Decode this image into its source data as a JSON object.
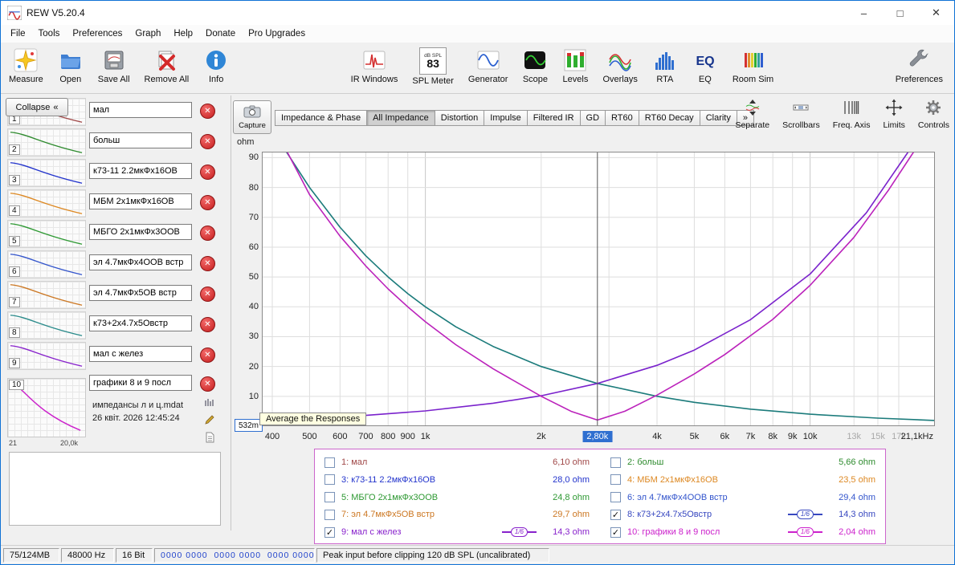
{
  "window": {
    "title": "REW V5.20.4",
    "minimize": "–",
    "maximize": "□",
    "close": "✕"
  },
  "menu": {
    "items": [
      "File",
      "Tools",
      "Preferences",
      "Graph",
      "Help",
      "Donate",
      "Pro Upgrades"
    ]
  },
  "toolbar": {
    "left": [
      {
        "label": "Measure",
        "icon": "measure-icon"
      },
      {
        "label": "Open",
        "icon": "open-icon"
      },
      {
        "label": "Save All",
        "icon": "save-all-icon"
      },
      {
        "label": "Remove All",
        "icon": "remove-all-icon"
      },
      {
        "label": "Info",
        "icon": "info-icon"
      }
    ],
    "center": [
      {
        "label": "IR Windows",
        "icon": "ir-windows-icon"
      },
      {
        "label": "SPL Meter",
        "icon": "spl-meter-icon"
      },
      {
        "label": "Generator",
        "icon": "generator-icon"
      },
      {
        "label": "Scope",
        "icon": "scope-icon"
      },
      {
        "label": "Levels",
        "icon": "levels-icon"
      },
      {
        "label": "Overlays",
        "icon": "overlays-icon"
      },
      {
        "label": "RTA",
        "icon": "rta-icon"
      },
      {
        "label": "EQ",
        "icon": "eq-icon"
      },
      {
        "label": "Room Sim",
        "icon": "room-sim-icon"
      }
    ],
    "right": [
      {
        "label": "Preferences",
        "icon": "wrench-icon"
      }
    ],
    "spl": {
      "unit": "dB SPL",
      "value": "83"
    }
  },
  "sidebar": {
    "collapse_label": "Collapse",
    "collapse_chevron": "«",
    "measurements": [
      {
        "num": "1",
        "name": "мал",
        "color": "#a04848"
      },
      {
        "num": "2",
        "name": "больш",
        "color": "#2e8b2e"
      },
      {
        "num": "3",
        "name": "к73-11 2.2мкФх16ОВ",
        "color": "#2233cc"
      },
      {
        "num": "4",
        "name": "МБМ 2х1мкФх16ОВ",
        "color": "#dd8822"
      },
      {
        "num": "5",
        "name": "МБГО 2х1мкФх3ООВ",
        "color": "#2e9933"
      },
      {
        "num": "6",
        "name": "эл 4.7мкФх4ООВ встр",
        "color": "#3355cc"
      },
      {
        "num": "7",
        "name": "эл 4.7мкФх5ОВ встр",
        "color": "#cc7722"
      },
      {
        "num": "8",
        "name": "к73+2х4.7х5Овстр",
        "color": "#2a8b8b"
      },
      {
        "num": "9",
        "name": "мал с желез",
        "color": "#8822cc"
      },
      {
        "num": "10",
        "name": "графики 8 и 9 посл",
        "color": "#cc22cc"
      }
    ],
    "selected": {
      "num": "10",
      "file": "импедансы л и ц.mdat",
      "date": "26 квіт. 2026 12:45:24",
      "axis_left": "21",
      "axis_right": "20,0k"
    }
  },
  "graphbar": {
    "capture_label": "Capture",
    "tabs": [
      {
        "label": "Impedance & Phase",
        "active": false
      },
      {
        "label": "All Impedance",
        "active": true
      },
      {
        "label": "Distortion",
        "active": false
      },
      {
        "label": "Impulse",
        "active": false
      },
      {
        "label": "Filtered IR",
        "active": false
      },
      {
        "label": "GD",
        "active": false
      },
      {
        "label": "RT60",
        "active": false
      },
      {
        "label": "RT60 Decay",
        "active": false
      },
      {
        "label": "Clarity",
        "active": false
      },
      {
        "label": "»",
        "active": false
      }
    ],
    "tools": [
      {
        "label": "Separate",
        "icon": "separate-icon"
      },
      {
        "label": "Scrollbars",
        "icon": "scrollbars-icon"
      },
      {
        "label": "Freq. Axis",
        "icon": "freq-axis-icon"
      },
      {
        "label": "Limits",
        "icon": "limits-icon"
      },
      {
        "label": "Controls",
        "icon": "controls-icon"
      }
    ]
  },
  "graph": {
    "ylabel": "ohm",
    "yticks": [
      90,
      80,
      70,
      60,
      50,
      40,
      30,
      20,
      10
    ],
    "xticks": [
      {
        "f": 400,
        "label": "400"
      },
      {
        "f": 500,
        "label": "500"
      },
      {
        "f": 600,
        "label": "600"
      },
      {
        "f": 700,
        "label": "700"
      },
      {
        "f": 800,
        "label": "800"
      },
      {
        "f": 900,
        "label": "900"
      },
      {
        "f": 1000,
        "label": "1k"
      },
      {
        "f": 2000,
        "label": "2k"
      },
      {
        "f": 4000,
        "label": "4k"
      },
      {
        "f": 5000,
        "label": "5k"
      },
      {
        "f": 6000,
        "label": "6k"
      },
      {
        "f": 7000,
        "label": "7k"
      },
      {
        "f": 8000,
        "label": "8k"
      },
      {
        "f": 9000,
        "label": "9k"
      },
      {
        "f": 10000,
        "label": "10k"
      },
      {
        "f": 13000,
        "label": "13k",
        "muted": true
      },
      {
        "f": 15000,
        "label": "15k",
        "muted": true
      },
      {
        "f": 17000,
        "label": "17k",
        "muted": true
      },
      {
        "f": 21100,
        "label": "21,1kHz"
      }
    ],
    "gridfreqs": [
      400,
      500,
      600,
      700,
      800,
      900,
      1000,
      2000,
      3000,
      4000,
      5000,
      6000,
      7000,
      8000,
      9000,
      10000,
      13000,
      15000,
      17000,
      21100
    ],
    "corner_value": "532m",
    "cursor_label": "2,80k",
    "cursor_freq": 2800,
    "tooltip": "Average the Responses"
  },
  "chart_data": {
    "type": "line",
    "x_scale": "log",
    "x_units": "Hz",
    "ylabel": "ohm",
    "xlim": [
      400,
      22500
    ],
    "ylim": [
      0.532,
      92
    ],
    "cursor": {
      "x": 2800,
      "label": "2,80k"
    },
    "series": [
      {
        "name": "8: к73+2х4.7х5Овстр",
        "color": "#1b7b7b",
        "cursor_value_ohm": 14.3,
        "points": [
          [
            430,
            93
          ],
          [
            500,
            80
          ],
          [
            600,
            66.7
          ],
          [
            700,
            57.1
          ],
          [
            800,
            50
          ],
          [
            900,
            44.4
          ],
          [
            1000,
            40
          ],
          [
            1200,
            33.3
          ],
          [
            1500,
            26.7
          ],
          [
            2000,
            20
          ],
          [
            2800,
            14.3
          ],
          [
            4000,
            10
          ],
          [
            5000,
            8
          ],
          [
            7000,
            5.7
          ],
          [
            10000,
            4
          ],
          [
            15000,
            2.7
          ],
          [
            21100,
            1.9
          ],
          [
            22500,
            1.8
          ]
        ]
      },
      {
        "name": "9: мал с желез",
        "color": "#7a22cc",
        "cursor_value_ohm": 14.3,
        "points": [
          [
            400,
            2.1
          ],
          [
            700,
            3.6
          ],
          [
            1000,
            5.1
          ],
          [
            1500,
            7.7
          ],
          [
            2000,
            10.2
          ],
          [
            2800,
            14.3
          ],
          [
            4000,
            20.4
          ],
          [
            5000,
            25.5
          ],
          [
            7000,
            35.7
          ],
          [
            10000,
            51
          ],
          [
            14000,
            71.5
          ],
          [
            18000,
            92
          ],
          [
            18300,
            96
          ]
        ]
      },
      {
        "name": "10: графики 8 и 9 посл",
        "color": "#bb22bb",
        "cursor_value_ohm": 2.04,
        "points": [
          [
            437,
            92
          ],
          [
            500,
            77.6
          ],
          [
            600,
            63.7
          ],
          [
            700,
            53.7
          ],
          [
            800,
            46
          ],
          [
            900,
            40
          ],
          [
            1000,
            35
          ],
          [
            1200,
            27.3
          ],
          [
            1500,
            19.2
          ],
          [
            2000,
            10
          ],
          [
            2400,
            4.9
          ],
          [
            2800,
            2.04
          ],
          [
            3300,
            5.0
          ],
          [
            4000,
            10.4
          ],
          [
            5000,
            17.5
          ],
          [
            6000,
            24
          ],
          [
            8000,
            35.8
          ],
          [
            10000,
            47.2
          ],
          [
            13000,
            63.3
          ],
          [
            16000,
            79.2
          ],
          [
            18600,
            92
          ],
          [
            18900,
            96
          ]
        ]
      }
    ]
  },
  "legend": {
    "items": [
      {
        "num": "1",
        "name": "мал",
        "value": "6,10 ohm",
        "checked": false,
        "color": "#a04848"
      },
      {
        "num": "2",
        "name": "больш",
        "value": "5,66 ohm",
        "checked": false,
        "color": "#2e8b2e"
      },
      {
        "num": "3",
        "name": "к73-11 2.2мкФх16ОВ",
        "value": "28,0 ohm",
        "checked": false,
        "color": "#2233cc"
      },
      {
        "num": "4",
        "name": "МБМ 2х1мкФх16ОВ",
        "value": "23,5 ohm",
        "checked": false,
        "color": "#dd8822"
      },
      {
        "num": "5",
        "name": "МБГО 2х1мкФх3ООВ",
        "value": "24,8 ohm",
        "checked": false,
        "color": "#2e9933"
      },
      {
        "num": "6",
        "name": "эл 4.7мкФх4ООВ встр",
        "value": "29,4 ohm",
        "checked": false,
        "color": "#3355cc"
      },
      {
        "num": "7",
        "name": "эл 4.7мкФх5ОВ встр",
        "value": "29,7 ohm",
        "checked": false,
        "color": "#cc7722"
      },
      {
        "num": "8",
        "name": "к73+2х4.7х5Овстр",
        "value": "14,3 ohm",
        "checked": true,
        "smoothing": "1/6",
        "color": "#3848c0"
      },
      {
        "num": "9",
        "name": "мал с желез",
        "value": "14,3 ohm",
        "checked": true,
        "smoothing": "1/6",
        "color": "#8822cc"
      },
      {
        "num": "10",
        "name": "графики 8 и 9 посл",
        "value": "2,04 ohm",
        "checked": true,
        "smoothing": "1/6",
        "color": "#cc22cc"
      }
    ]
  },
  "statusbar": {
    "segments": [
      "75/124MB",
      "48000 Hz",
      "16 Bit",
      "0000 0000  0000 0000  0000 0000",
      "Peak input before clipping 120 dB SPL (uncalibrated)"
    ]
  }
}
